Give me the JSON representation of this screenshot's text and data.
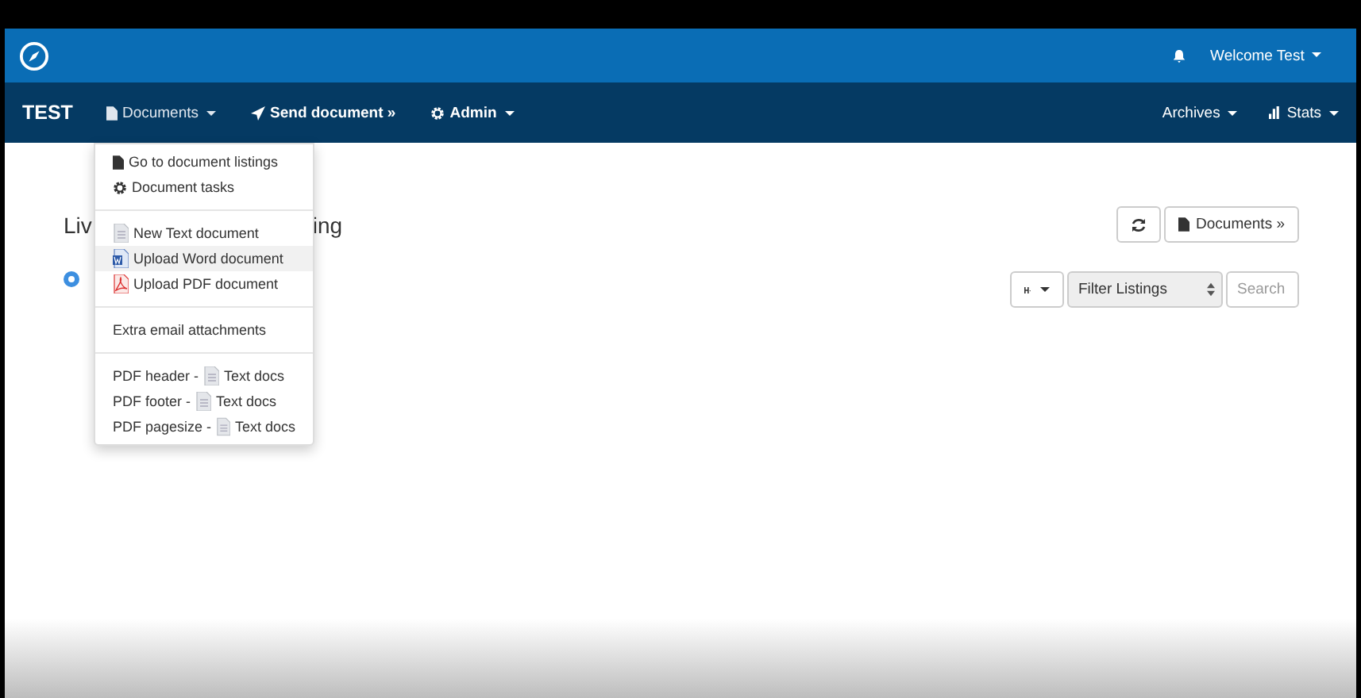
{
  "top_bar": {
    "user_menu": "Welcome Test"
  },
  "nav": {
    "brand": "TEST",
    "left_items": [
      {
        "label": "Documents",
        "kind": "menu",
        "open": true
      },
      {
        "label": "Send document »",
        "kind": "link",
        "open": false
      },
      {
        "label": "Admin",
        "kind": "menu",
        "open": false
      }
    ],
    "right_items": [
      {
        "label": "Archives"
      },
      {
        "label": "Stats"
      }
    ]
  },
  "heading": {
    "left": "Liv",
    "right": "ing"
  },
  "toolbar": {
    "documents_button": "Documents »"
  },
  "filter": {
    "select": "Filter Listings",
    "search_placeholder": "Search"
  },
  "dropdown": {
    "items": [
      {
        "kind": "item",
        "label": "Go to document listings",
        "selected": false
      },
      {
        "kind": "item",
        "label": "Document tasks",
        "selected": false
      },
      {
        "kind": "divider"
      },
      {
        "kind": "item",
        "label": "New Text document",
        "selected": false
      },
      {
        "kind": "item",
        "label": "Upload Word document",
        "selected": true
      },
      {
        "kind": "item",
        "label": "Upload PDF document",
        "selected": false
      },
      {
        "kind": "divider"
      },
      {
        "kind": "item",
        "label": "Extra email attachments",
        "selected": false
      },
      {
        "kind": "divider"
      },
      {
        "kind": "pair",
        "label": "PDF header -",
        "target": "Text docs",
        "selected": false
      },
      {
        "kind": "pair",
        "label": "PDF footer -",
        "target": "Text docs",
        "selected": false
      },
      {
        "kind": "pair",
        "label": "PDF pagesize -",
        "target": "Text docs",
        "selected": false
      }
    ]
  }
}
